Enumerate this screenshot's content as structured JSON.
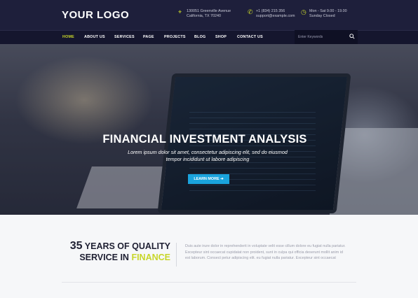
{
  "header": {
    "logo": "YOUR LOGO",
    "address_line1": "130051 Greenville Avenue",
    "address_line2": "California, TX 70240",
    "phone": "+1 (834) 215 356",
    "email": "support@example.com",
    "hours_line1": "Mon - Sat 9.00 - 19.00",
    "hours_line2": "Sunday Closed",
    "accent_color": "#c8d62a"
  },
  "nav": {
    "items": [
      "HOME",
      "ABOUT US",
      "SERVICES",
      "PAGE",
      "PROJECTS",
      "BLOG",
      "SHOP",
      "CONTACT US"
    ],
    "search_placeholder": "Enter Keywords"
  },
  "hero": {
    "title": "FINANCIAL INVESTMENT ANALYSIS",
    "subtitle": "Lorem ipsum dolor sit amet, consectetur adipiscing elit, sed do eiusmod tempor incididunt ut labore adipiscing",
    "button_label": "LEARN MORE",
    "button_color": "#1aa3dc"
  },
  "about": {
    "years": "35",
    "title_part1": "YEARS OF QUALITY",
    "title_part2": "SERVICE IN",
    "title_accent": "FINANCE",
    "text": "Duis aute irure dolor in reprehenderit in voluptate velit esse cillum dolore eu fugiat nulla pariatur. Excepteur sint occaecat cupidatat non proident, sunt in culpa qui officia deserunt mollit anim id est laborum. Consect petur adipiscing elit. eu fugiat nulla pariatur. Excepteur sint occaecat"
  }
}
